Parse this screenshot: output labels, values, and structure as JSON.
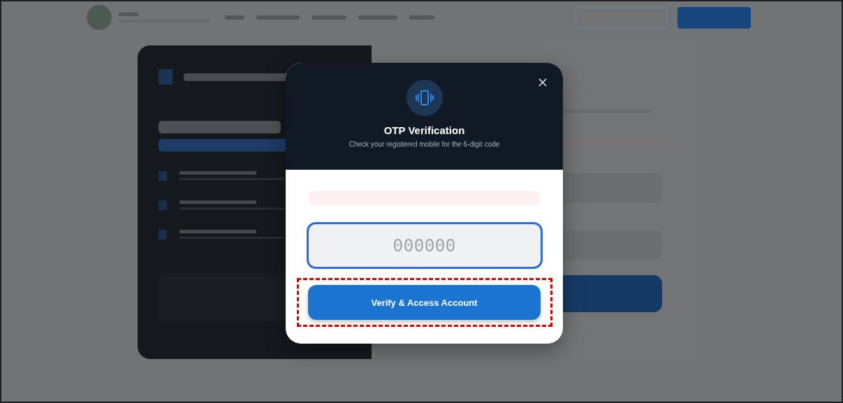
{
  "modal": {
    "title": "OTP Verification",
    "subtitle": "Check your registered mobile for the 6-digit code",
    "otp_field": {
      "placeholder": "000000",
      "focused": true
    },
    "verify_button": "Verify & Access Account"
  }
}
